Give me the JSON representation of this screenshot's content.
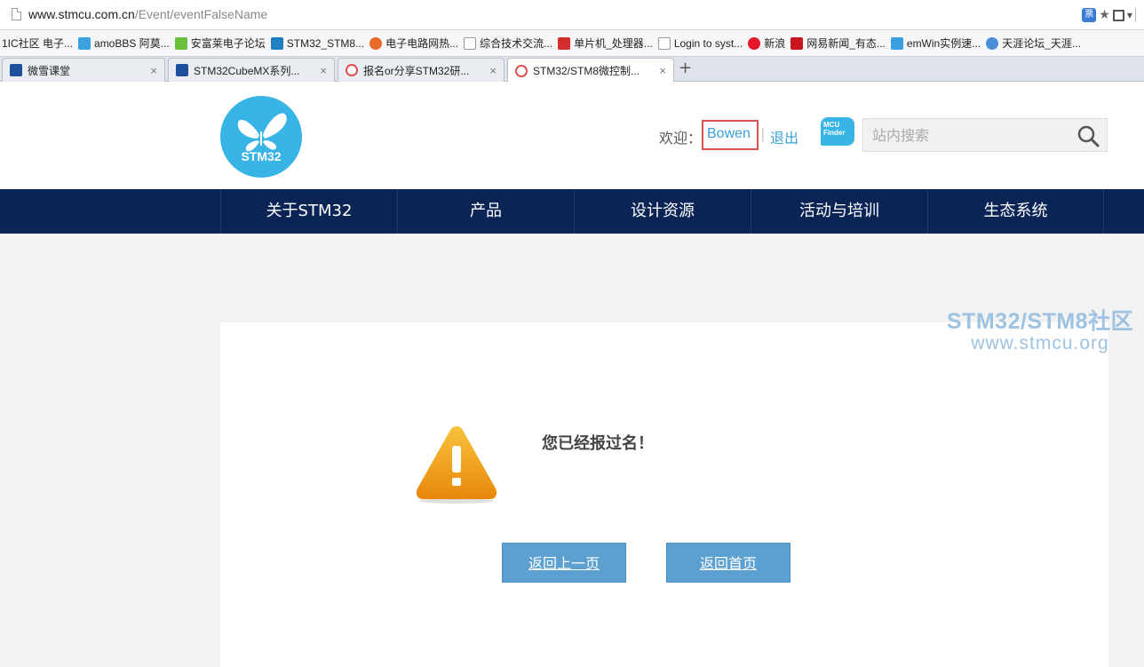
{
  "browser": {
    "url_host": "www.stmcu.com.cn",
    "url_path": "/Event/eventFalseName",
    "bookmarks": [
      "1IC社区 电子...",
      "amoBBS 阿莫...",
      "安富莱电子论坛",
      "STM32_STM8...",
      "电子电路网热...",
      "综合技术交流...",
      "单片机_处理器...",
      "Login to syst...",
      "新浪",
      "网易新闻_有态...",
      "emWin实例速...",
      "天涯论坛_天涯..."
    ],
    "tabs": [
      {
        "title": "微雪课堂"
      },
      {
        "title": "STM32CubeMX系列..."
      },
      {
        "title": "报名or分享STM32研..."
      },
      {
        "title": "STM32/STM8微控制..."
      }
    ],
    "new_tab_symbol": "+",
    "tab_close_symbol": "×"
  },
  "header": {
    "logo_text": "STM32",
    "welcome_label": "欢迎：",
    "username": "Bowen",
    "separator": "|",
    "logout_label": "退出",
    "mcu_finder_line1": "MCU",
    "mcu_finder_line2": "Finder",
    "search_placeholder": "站内搜索"
  },
  "nav": {
    "items": [
      "关于STM32",
      "产品",
      "设计资源",
      "活动与培训",
      "生态系统"
    ]
  },
  "watermark": {
    "line1": "STM32/STM8社区",
    "line2": "www.stmcu.org"
  },
  "content": {
    "message": "您已经报过名！",
    "back_button": "返回上一页",
    "home_button": "返回首页"
  },
  "colors": {
    "nav_bg": "#0a2456",
    "accent": "#39b4e6",
    "button": "#5ba0d0",
    "highlight_box": "#d9534f"
  }
}
